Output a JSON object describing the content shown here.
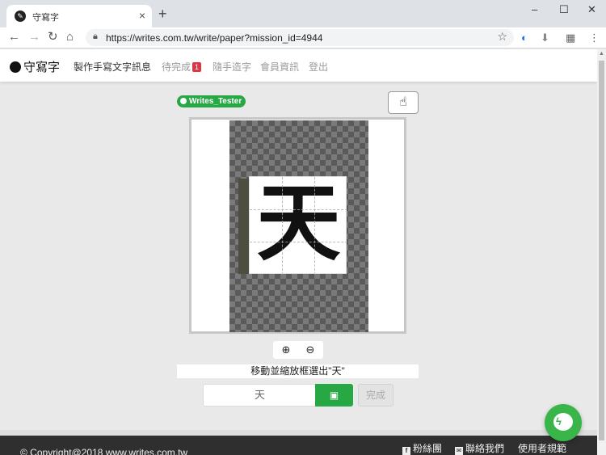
{
  "browser": {
    "tab_title": "守寫字",
    "tab_close": "×",
    "new_tab": "+",
    "url": "https://writes.com.tw/write/paper?mission_id=4944",
    "window_controls": {
      "minimize": "–",
      "maximize": "☐",
      "close": "✕"
    }
  },
  "site": {
    "logo_text": "守寫字",
    "nav": [
      {
        "label": "製作手寫文字訊息"
      },
      {
        "label": "待完成",
        "badge": "1"
      },
      {
        "label": "隨手造字"
      },
      {
        "label": "會員資訊"
      },
      {
        "label": "登出"
      }
    ]
  },
  "workspace": {
    "user_name": "Writes_Tester",
    "glyph": "天",
    "instruction": "移動並縮放框選出\"天\"",
    "answer_value": "天",
    "done_label": "完成"
  },
  "footer": {
    "copyright": "© Copyright@2018 www.writes.com.tw",
    "links": [
      {
        "label": "粉絲團"
      },
      {
        "label": "聯絡我們"
      },
      {
        "label": "使用者規範"
      }
    ]
  },
  "colors": {
    "accent_green": "#28a745",
    "badge_red": "#dc3545",
    "footer_dark": "#2f2f2f"
  },
  "icons": {
    "pointer": "hand-pointer-icon",
    "zoom_in": "zoom-in-icon",
    "zoom_out": "zoom-out-icon",
    "save": "save-icon",
    "messenger": "messenger-icon"
  }
}
